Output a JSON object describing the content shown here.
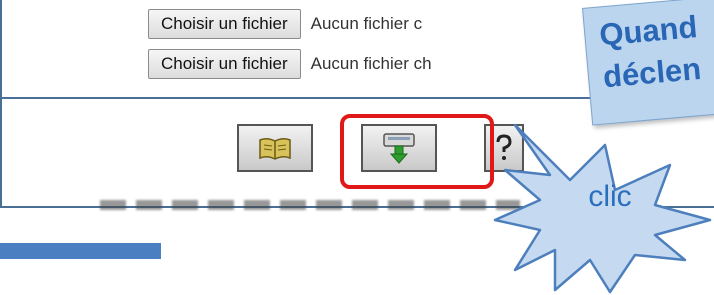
{
  "file_inputs": [
    {
      "button_label": "Choisir un fichier",
      "status_text": "Aucun fichier c"
    },
    {
      "button_label": "Choisir un fichier",
      "status_text": "Aucun fichier ch"
    }
  ],
  "toolbar": {
    "buttons": [
      {
        "icon": "book-icon"
      },
      {
        "icon": "upload-icon"
      },
      {
        "icon": "help-icon"
      }
    ]
  },
  "annotation": {
    "callout_line1": "Quand",
    "callout_line2": "déclen",
    "burst_label": "clic",
    "callout_color": "#2a66b6",
    "highlight_color": "#e01818"
  }
}
